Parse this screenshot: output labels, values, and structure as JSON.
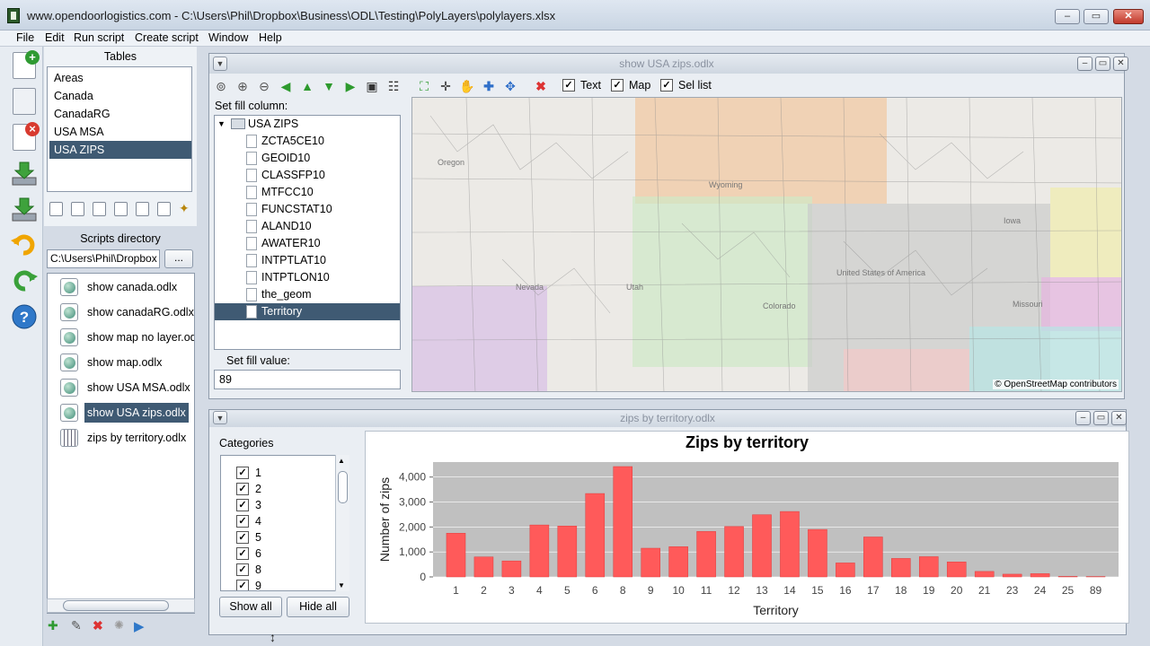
{
  "window": {
    "title": "www.opendoorlogistics.com - C:\\Users\\Phil\\Dropbox\\Business\\ODL\\Testing\\PolyLayers\\polylayers.xlsx",
    "min": "–",
    "max": "▭",
    "close": "✕"
  },
  "menu": [
    "File",
    "Edit",
    "Run script",
    "Create script",
    "Window",
    "Help"
  ],
  "tables": {
    "title": "Tables",
    "items": [
      "Areas",
      "Canada",
      "CanadaRG",
      "USA MSA",
      "USA ZIPS"
    ],
    "selected": "USA ZIPS"
  },
  "scripts": {
    "title": "Scripts directory",
    "path": "C:\\Users\\Phil\\Dropbox",
    "browse_label": "...",
    "items": [
      "show canada.odlx",
      "show canadaRG.odlx",
      "show map no layer.odlx",
      "show map.odlx",
      "show USA MSA.odlx",
      "show USA zips.odlx",
      "zips by territory.odlx"
    ],
    "selected": "show USA zips.odlx"
  },
  "map_window": {
    "title": "show USA zips.odlx",
    "toolbar": {
      "text_label": "Text",
      "text_checked": true,
      "map_label": "Map",
      "map_checked": true,
      "sel_label": "Sel list",
      "sel_checked": true
    },
    "fill_column_label": "Set fill column:",
    "tree_root": "USA ZIPS",
    "columns": [
      "ZCTA5CE10",
      "GEOID10",
      "CLASSFP10",
      "MTFCC10",
      "FUNCSTAT10",
      "ALAND10",
      "AWATER10",
      "INTPTLAT10",
      "INTPTLON10",
      "the_geom",
      "Territory"
    ],
    "selected_column": "Territory",
    "fill_value_label": "Set fill value:",
    "fill_value": "89",
    "map_labels": [
      "Oregon",
      "Wyoming",
      "Iowa",
      "Nevada",
      "Utah",
      "United States of America",
      "Colorado",
      "Missouri"
    ],
    "attribution": "© OpenStreetMap contributors",
    "colors": {
      "orange": "#f2c7a0",
      "green": "#cfe8c6",
      "purple": "#d9bfe6",
      "yellow": "#f0ecb0",
      "magenta": "#e6b3e0",
      "cyan": "#b6e6e6",
      "pink": "#f4c8c8",
      "grey": "#c9c9c9"
    }
  },
  "chart_window": {
    "title": "zips by territory.odlx",
    "categories_label": "Categories",
    "visible_categories": [
      "1",
      "2",
      "3",
      "4",
      "5",
      "6",
      "8",
      "9"
    ],
    "show_all_label": "Show all",
    "hide_all_label": "Hide all"
  },
  "chart_data": {
    "type": "bar",
    "title": "Zips by territory",
    "xlabel": "Territory",
    "ylabel": "Number of zips",
    "categories": [
      "1",
      "2",
      "3",
      "4",
      "5",
      "6",
      "8",
      "9",
      "10",
      "11",
      "12",
      "13",
      "14",
      "15",
      "16",
      "17",
      "18",
      "19",
      "20",
      "21",
      "23",
      "24",
      "25",
      "89"
    ],
    "values": [
      1750,
      800,
      640,
      2080,
      2040,
      3340,
      4420,
      1150,
      1210,
      1820,
      2020,
      2490,
      2620,
      1900,
      560,
      1600,
      740,
      810,
      600,
      220,
      110,
      130,
      20,
      15
    ],
    "yticks": [
      0,
      1000,
      2000,
      3000,
      4000
    ],
    "ytick_labels": [
      "0",
      "1,000",
      "2,000",
      "3,000",
      "4,000"
    ],
    "ylim": [
      0,
      4600
    ],
    "bar_color": "#ff5a5a",
    "plot_background": "#c0c0c0",
    "grid": true
  }
}
